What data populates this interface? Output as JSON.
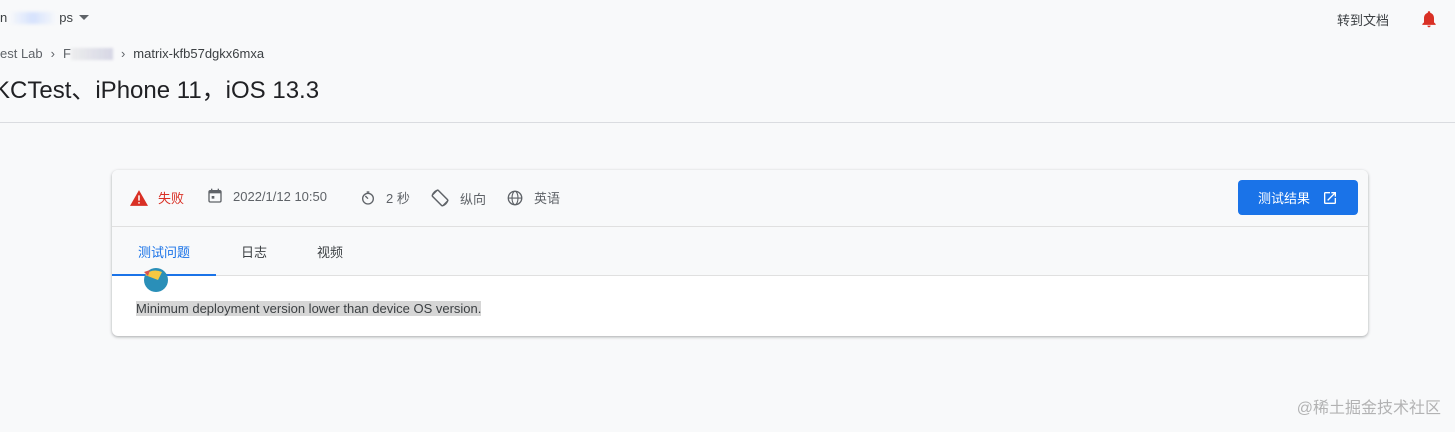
{
  "topbar": {
    "project_prefix": "n",
    "project_suffix": "ps",
    "goto_docs": "转到文档"
  },
  "breadcrumb": {
    "item1": "est Lab",
    "item2_visible": "F",
    "current": "matrix-kfb57dgkx6mxa"
  },
  "page": {
    "title": "KCTest、iPhone 11，iOS 13.3"
  },
  "card": {
    "status": "失败",
    "date": "2022/1/12 10:50",
    "duration": "2 秒",
    "orientation": "纵向",
    "language": "英语",
    "results_button": "测试结果",
    "tabs": [
      "测试问题",
      "日志",
      "视频"
    ],
    "active_tab": 0,
    "issue": "Minimum deployment version lower than device OS version."
  },
  "colors": {
    "accent": "#1a73e8",
    "error": "#d93025"
  },
  "watermark": "@稀土掘金技术社区"
}
